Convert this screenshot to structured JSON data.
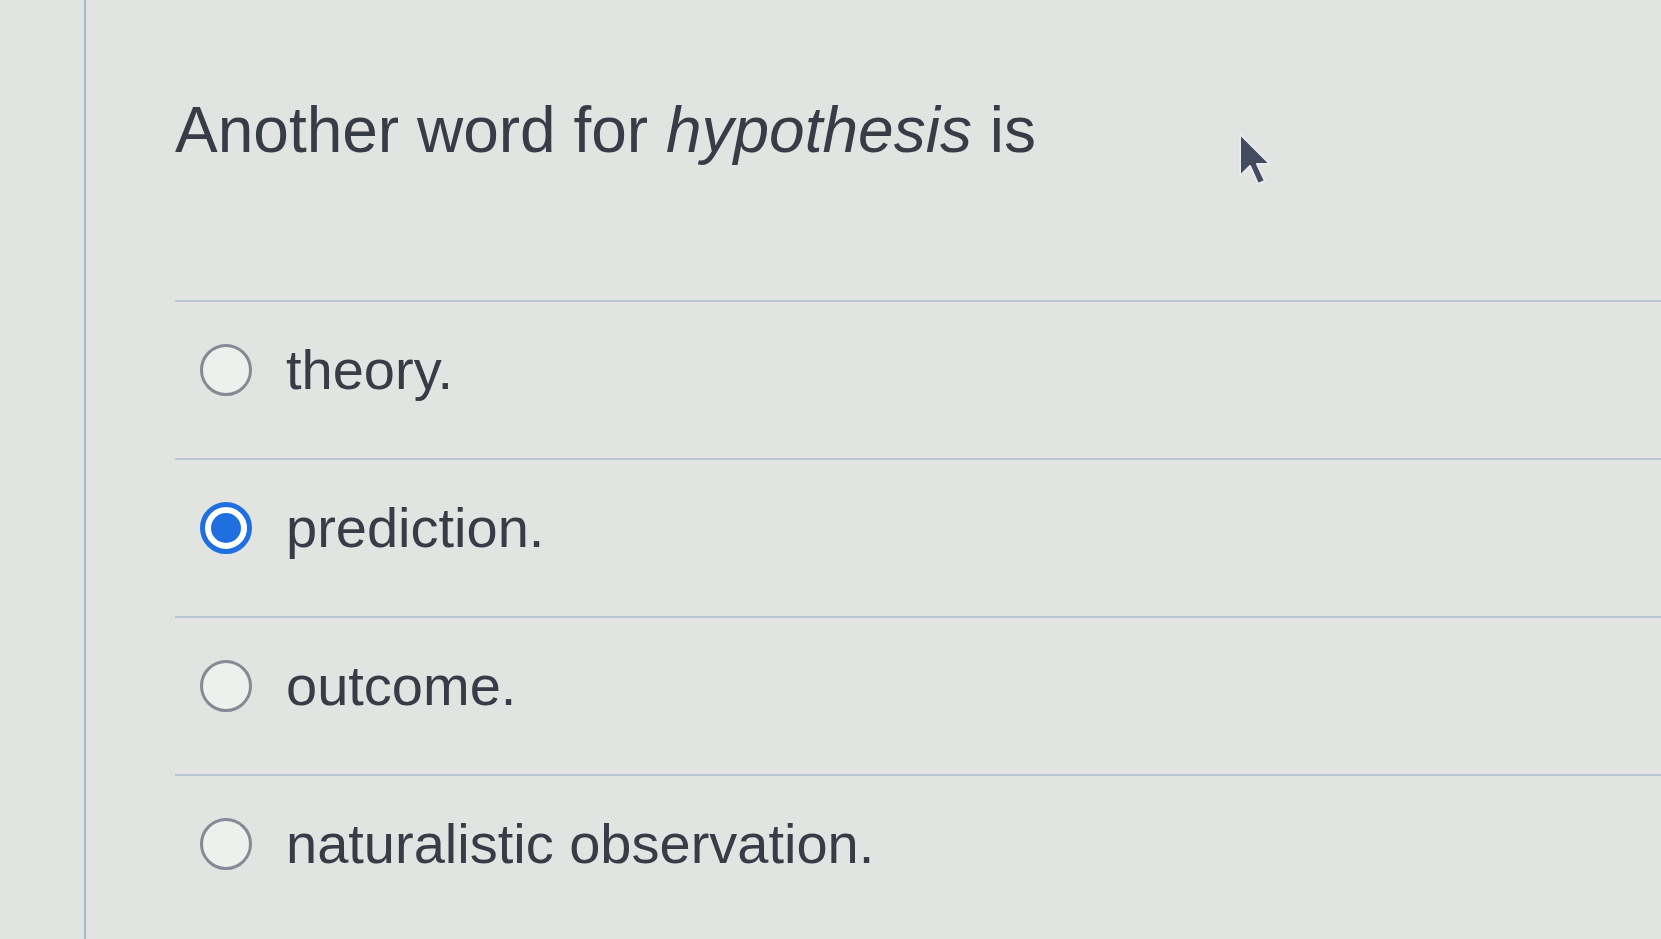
{
  "question": {
    "text": "Another word for *hypothesis* is"
  },
  "options": [
    {
      "label": "theory.",
      "selected": false
    },
    {
      "label": "prediction.",
      "selected": true
    },
    {
      "label": "outcome.",
      "selected": false
    },
    {
      "label": "naturalistic observation.",
      "selected": false
    }
  ]
}
